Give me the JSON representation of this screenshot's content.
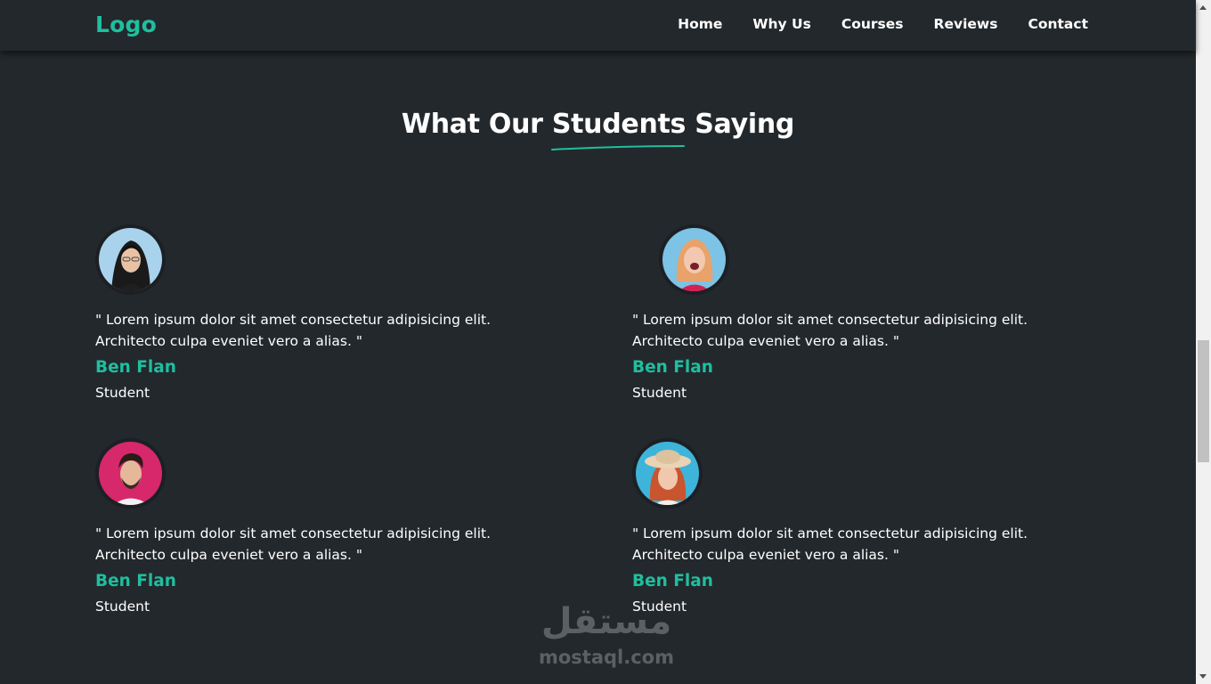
{
  "nav": {
    "logo": "Logo",
    "links": [
      "Home",
      "Why Us",
      "Courses",
      "Reviews",
      "Contact"
    ]
  },
  "section": {
    "title_part1": "What Our",
    "title_highlight": "Students",
    "title_part2": "Saying"
  },
  "testimonials": [
    {
      "quote": "\" Lorem ipsum dolor sit amet consectetur adipisicing elit. Architecto culpa eveniet vero a alias. \"",
      "name": "Ben Flan",
      "role": "Student"
    },
    {
      "quote": "\" Lorem ipsum dolor sit amet consectetur adipisicing elit. Architecto culpa eveniet vero a alias. \"",
      "name": "Ben Flan",
      "role": "Student"
    },
    {
      "quote": "\" Lorem ipsum dolor sit amet consectetur adipisicing elit. Architecto culpa eveniet vero a alias. \"",
      "name": "Ben Flan",
      "role": "Student"
    },
    {
      "quote": "\" Lorem ipsum dolor sit amet consectetur adipisicing elit. Architecto culpa eveniet vero a alias. \"",
      "name": "Ben Flan",
      "role": "Student"
    }
  ],
  "watermark": {
    "arabic": "مستقل",
    "latin": "mostaql.com"
  },
  "colors": {
    "accent": "#1fbf9f",
    "background": "#23282c"
  }
}
